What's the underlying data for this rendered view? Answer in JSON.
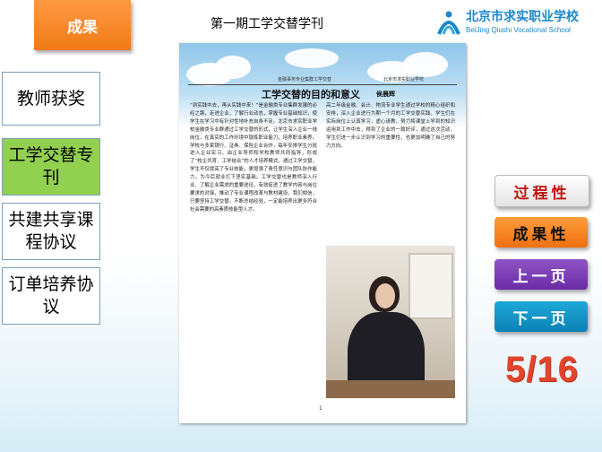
{
  "header": {
    "tab_label": "成果",
    "page_title": "第一期工学交替学刊",
    "logo_cn": "北京市求实职业学校",
    "logo_en": "BeiJing Qiushi Vocational School"
  },
  "sidebar": {
    "items": [
      {
        "label": "教师获奖"
      },
      {
        "label": "工学交替专刊"
      },
      {
        "label": "共建共享课程协议"
      },
      {
        "label": "订单培养协议"
      }
    ]
  },
  "document": {
    "header_left": "金融事务专业集群工学交替",
    "header_right": "北京市求实职业学校",
    "title": "工学交替的目的和意义",
    "author": "侯晨辉",
    "left_column": "“到实践中去，再从实践中来！”是金融类专业集群发展的必经之路，走进企业，了解行业动态，掌握专业基础知识，使学生在学习中有针对性地补充自身不足。北京市求实职业学校金融类专业群通过工学交替的形式，让学生深入企业一线岗位，在真实的工作环境中锻炼职业能力，培养职业素养。学校与多家银行、证券、保险企业合作，每年安排学生分批进入企业实习，由企业导师和学校教师共同指导，形成了“校企共育、工学结合”的人才培养模式。通过工学交替，学生不仅提高了专业技能，更增强了责任意识与团队协作能力，为今后就业打下坚实基础。工学交替也是教师深入行业、了解企业需求的重要途径，有效促进了教学内容与岗位要求的对接，推动了专业课程改革与教材建设。我们相信，只要坚持工学交替，不断总结经验，一定能培养出更多符合社会需要的高素质技能型人才。",
    "right_column": "高二年级金融、会计、物流专业学生通过学校的精心组织和安排，深入企业进行为期一个月的工学交替实践。学生们在实际岗位上认真学习，虚心请教，努力将课堂上学到的知识运用到工作中去，得到了企业的一致好评。通过这次活动，学生们进一步认识到学习的重要性，也更加明确了自己的努力方向。",
    "page_number": "1"
  },
  "buttons": {
    "process": "过程性",
    "result": "成果性",
    "prev": "上一页",
    "next": "下一页"
  },
  "pagination": {
    "counter": "5/16"
  }
}
